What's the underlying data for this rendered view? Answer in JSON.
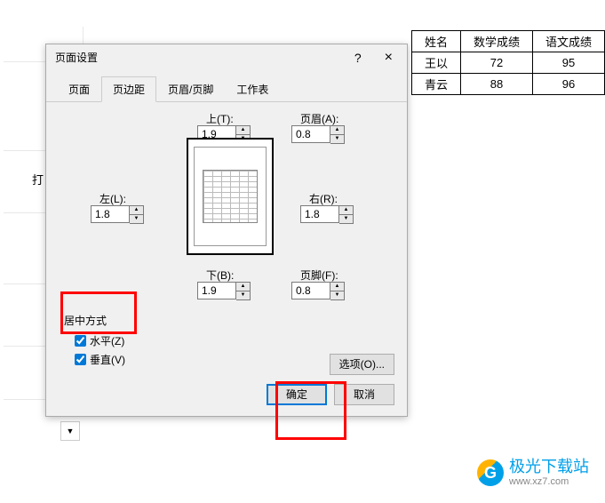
{
  "dialog": {
    "title": "页面设置",
    "help": "?",
    "close": "×",
    "tabs": [
      "页面",
      "页边距",
      "页眉/页脚",
      "工作表"
    ],
    "active_tab": 1,
    "margins": {
      "top": {
        "label": "上(T):",
        "value": "1.9"
      },
      "header": {
        "label": "页眉(A):",
        "value": "0.8"
      },
      "left": {
        "label": "左(L):",
        "value": "1.8"
      },
      "right": {
        "label": "右(R):",
        "value": "1.8"
      },
      "bottom": {
        "label": "下(B):",
        "value": "1.9"
      },
      "footer": {
        "label": "页脚(F):",
        "value": "0.8"
      }
    },
    "center_method": {
      "title": "居中方式",
      "horizontal": {
        "label": "水平(Z)",
        "checked": true
      },
      "vertical": {
        "label": "垂直(V)",
        "checked": true
      }
    },
    "options_btn": "选项(O)...",
    "ok_btn": "确定",
    "cancel_btn": "取消"
  },
  "bg_table": {
    "headers": [
      "姓名",
      "数学成绩",
      "语文成绩"
    ],
    "rows": [
      [
        "王以",
        "72",
        "95"
      ],
      [
        "青云",
        "88",
        "96"
      ]
    ]
  },
  "bg_text": "打",
  "watermark": {
    "name": "极光下载站",
    "url": "www.xz7.com"
  }
}
